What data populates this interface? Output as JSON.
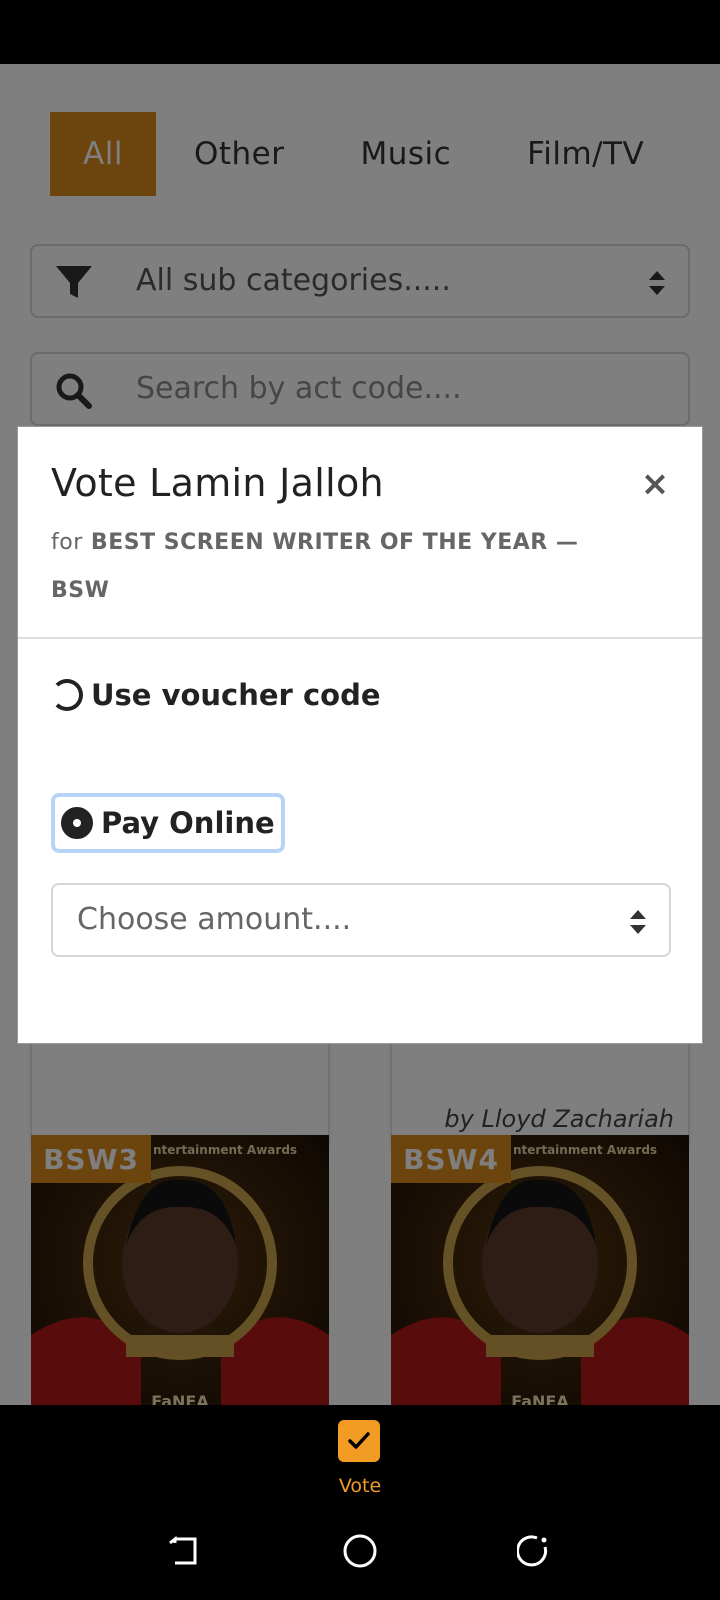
{
  "categories": {
    "tabs": [
      {
        "label": "All",
        "active": true
      },
      {
        "label": "Other",
        "active": false
      },
      {
        "label": "Music",
        "active": false
      },
      {
        "label": "Film/TV",
        "active": false
      }
    ]
  },
  "filter": {
    "icon": "filter-icon",
    "selected": "All sub categories....."
  },
  "search": {
    "icon": "search-icon",
    "placeholder": "Search by act code...."
  },
  "cards": {
    "card2_caption": "by Lloyd Zachariah"
  },
  "posters": [
    {
      "code": "BSW3",
      "header": "ntertainment Awards",
      "footer": "FaNEA"
    },
    {
      "code": "BSW4",
      "header": "ntertainment Awards",
      "footer": "FaNEA"
    }
  ],
  "modal": {
    "title": "Vote Lamin Jalloh",
    "subtitle_prefix": "for",
    "subtitle": "BEST SCREEN WRITER OF THE YEAR — BSW",
    "close_icon": "close-icon",
    "options": {
      "voucher": {
        "label": "Use voucher code",
        "checked": false
      },
      "pay_online": {
        "label": "Pay Online",
        "checked": true
      }
    },
    "amount_select": {
      "placeholder": "Choose amount...."
    }
  },
  "tabbar": {
    "vote_label": "Vote",
    "vote_icon": "checkbox-check-icon",
    "accent": "#f39c24"
  },
  "colors": {
    "primary": "#d98a1c",
    "accent": "#f39c24"
  }
}
